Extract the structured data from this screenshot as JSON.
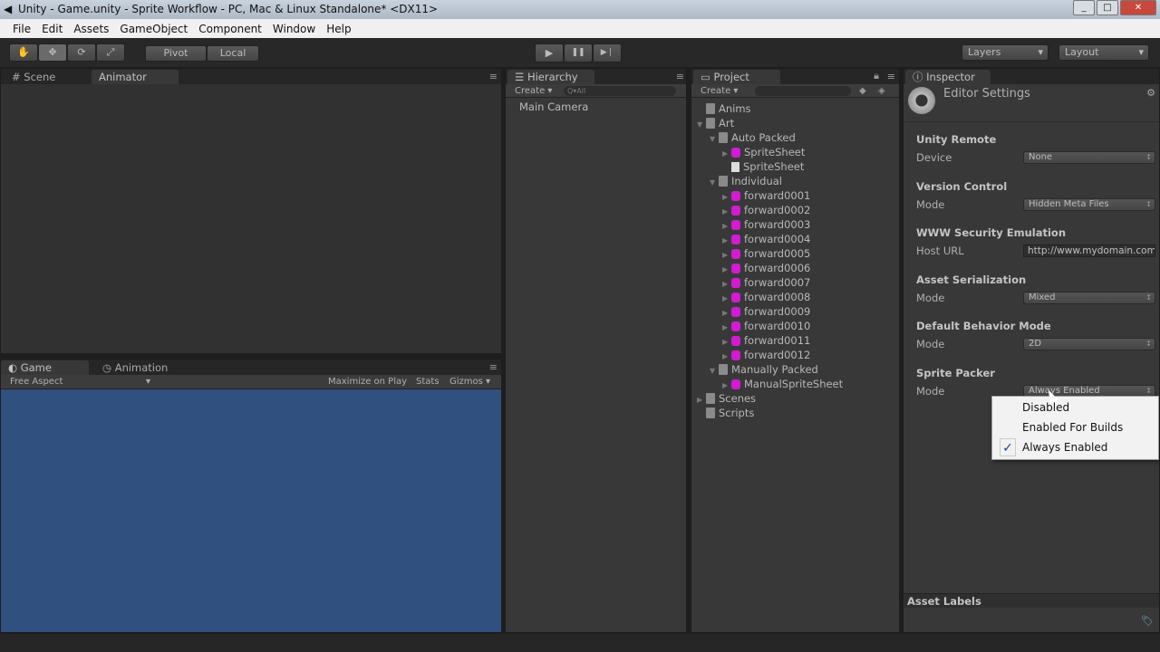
{
  "window": {
    "title": "Unity - Game.unity - Sprite Workflow - PC, Mac & Linux Standalone* <DX11>",
    "min": "_",
    "max": "□",
    "close": "✕"
  },
  "menu": [
    "File",
    "Edit",
    "Assets",
    "GameObject",
    "Component",
    "Window",
    "Help"
  ],
  "toolbar": {
    "tools": [
      "✋",
      "✥",
      "⟳",
      "⤢"
    ],
    "pivot": "Pivot",
    "local": "Local",
    "play": "▶",
    "pause": "❚❚",
    "step": "▶❘",
    "layers": "Layers",
    "layout": "Layout"
  },
  "scene_panel": {
    "tabs": [
      "Scene",
      "Animator"
    ]
  },
  "game_panel": {
    "tabs": [
      "Game",
      "Animation"
    ],
    "aspect": "Free Aspect",
    "maximize": "Maximize on Play",
    "stats": "Stats",
    "gizmos": "Gizmos",
    "bg": "#30507f"
  },
  "hierarchy": {
    "tab": "Hierarchy",
    "create": "Create",
    "search_placeholder": "Q▾All",
    "items": [
      "Main Camera"
    ]
  },
  "project": {
    "tab": "Project",
    "create": "Create",
    "items": [
      {
        "label": "Anims",
        "depth": 0,
        "icon": "folder",
        "arrow": ""
      },
      {
        "label": "Art",
        "depth": 0,
        "icon": "folder",
        "arrow": "▼"
      },
      {
        "label": "Auto Packed",
        "depth": 1,
        "icon": "folder",
        "arrow": "▼"
      },
      {
        "label": "SpriteSheet",
        "depth": 2,
        "icon": "sprite",
        "arrow": "▶"
      },
      {
        "label": "SpriteSheet",
        "depth": 2,
        "icon": "doc",
        "arrow": ""
      },
      {
        "label": "Individual",
        "depth": 1,
        "icon": "folder",
        "arrow": "▼"
      },
      {
        "label": "forward0001",
        "depth": 2,
        "icon": "sprite",
        "arrow": "▶"
      },
      {
        "label": "forward0002",
        "depth": 2,
        "icon": "sprite",
        "arrow": "▶"
      },
      {
        "label": "forward0003",
        "depth": 2,
        "icon": "sprite",
        "arrow": "▶"
      },
      {
        "label": "forward0004",
        "depth": 2,
        "icon": "sprite",
        "arrow": "▶"
      },
      {
        "label": "forward0005",
        "depth": 2,
        "icon": "sprite",
        "arrow": "▶"
      },
      {
        "label": "forward0006",
        "depth": 2,
        "icon": "sprite",
        "arrow": "▶"
      },
      {
        "label": "forward0007",
        "depth": 2,
        "icon": "sprite",
        "arrow": "▶"
      },
      {
        "label": "forward0008",
        "depth": 2,
        "icon": "sprite",
        "arrow": "▶"
      },
      {
        "label": "forward0009",
        "depth": 2,
        "icon": "sprite",
        "arrow": "▶"
      },
      {
        "label": "forward0010",
        "depth": 2,
        "icon": "sprite",
        "arrow": "▶"
      },
      {
        "label": "forward0011",
        "depth": 2,
        "icon": "sprite",
        "arrow": "▶"
      },
      {
        "label": "forward0012",
        "depth": 2,
        "icon": "sprite",
        "arrow": "▶"
      },
      {
        "label": "Manually Packed",
        "depth": 1,
        "icon": "folder",
        "arrow": "▼"
      },
      {
        "label": "ManualSpriteSheet",
        "depth": 2,
        "icon": "sprite",
        "arrow": "▶"
      },
      {
        "label": "Scenes",
        "depth": 0,
        "icon": "folder",
        "arrow": "▶"
      },
      {
        "label": "Scripts",
        "depth": 0,
        "icon": "folder",
        "arrow": ""
      }
    ]
  },
  "inspector": {
    "tab": "Inspector",
    "title": "Editor Settings",
    "asset_labels": "Asset Labels",
    "sections": [
      {
        "title": "Unity Remote",
        "label": "Device",
        "value": "None",
        "kind": "dropdown"
      },
      {
        "title": "Version Control",
        "label": "Mode",
        "value": "Hidden Meta Files",
        "kind": "dropdown"
      },
      {
        "title": "WWW Security Emulation",
        "label": "Host URL",
        "value": "http://www.mydomain.com",
        "kind": "text"
      },
      {
        "title": "Asset Serialization",
        "label": "Mode",
        "value": "Mixed",
        "kind": "dropdown"
      },
      {
        "title": "Default Behavior Mode",
        "label": "Mode",
        "value": "2D",
        "kind": "dropdown"
      },
      {
        "title": "Sprite Packer",
        "label": "Mode",
        "value": "Always Enabled",
        "kind": "dropdown"
      }
    ]
  },
  "popup": {
    "options": [
      "Disabled",
      "Enabled For Builds",
      "Always Enabled"
    ],
    "selected": "Always Enabled",
    "check": "✓"
  }
}
